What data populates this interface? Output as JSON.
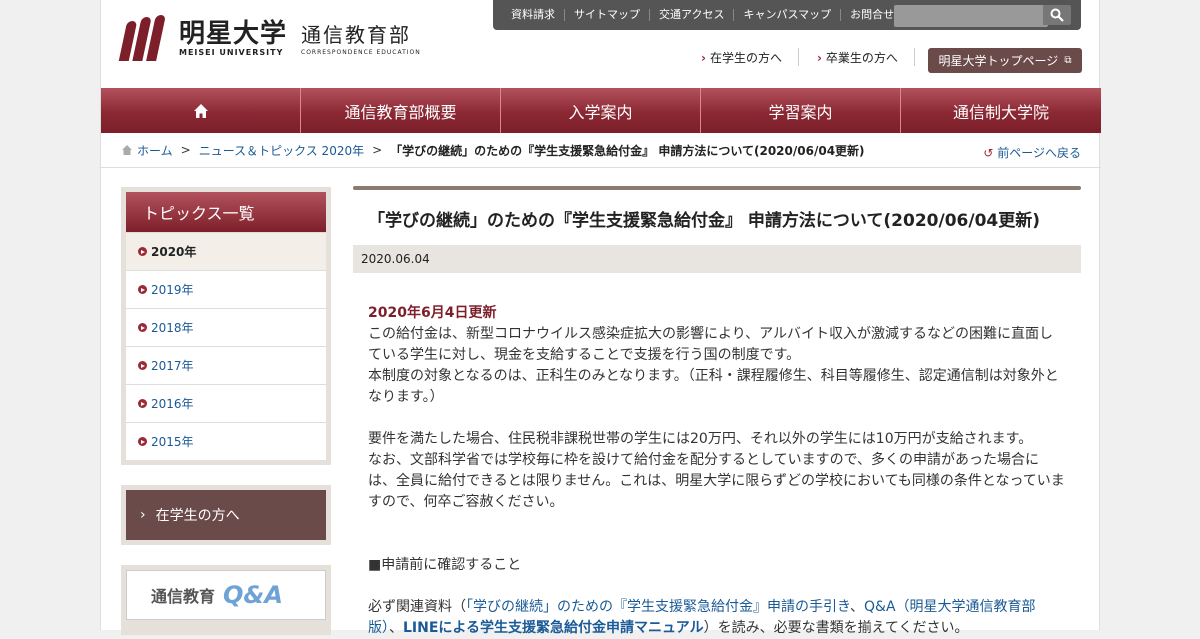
{
  "logo": {
    "brand_ja": "明星大学",
    "brand_en": "MEISEI UNIVERSITY",
    "dept_ja": "通信教育部",
    "dept_en": "CORRESPONDENCE EDUCATION"
  },
  "util_links": [
    "資料請求",
    "サイトマップ",
    "交通アクセス",
    "キャンパスマップ",
    "お問合せ"
  ],
  "search": {
    "placeholder": ""
  },
  "sub_links": [
    "在学生の方へ",
    "卒業生の方へ"
  ],
  "top_button": "明星大学トップページ",
  "gnav": [
    "通信教育部概要",
    "入学案内",
    "学習案内",
    "通信制大学院"
  ],
  "breadcrumb": {
    "home": "ホーム",
    "news": "ニュース＆トピックス 2020年",
    "current": "「学びの継続」のための『学生支援緊急給付金』 申請方法について(2020/06/04更新)",
    "back": "前ページへ戻る"
  },
  "sidebar": {
    "topics_title": "トピックス一覧",
    "years": [
      "2020年",
      "2019年",
      "2018年",
      "2017年",
      "2016年",
      "2015年"
    ],
    "student_link": "在学生の方へ",
    "qa_text": "通信教育",
    "qa_mark": "Q&A"
  },
  "article": {
    "title": "「学びの継続」のための『学生支援緊急給付金』 申請方法について(2020/06/04更新)",
    "date": "2020.06.04",
    "update": "2020年6月4日更新",
    "p1": "この給付金は、新型コロナウイルス感染症拡大の影響により、アルバイト収入が激減するなどの困難に直面している学生に対し、現金を支給することで支援を行う国の制度です。",
    "p2": "本制度の対象となるのは、正科生のみとなります。（正科・課程履修生、科目等履修生、認定通信制は対象外となります。）",
    "p3": "要件を満たした場合、住民税非課税世帯の学生には20万円、それ以外の学生には10万円が支給されます。",
    "p4": "なお、文部科学省では学校毎に枠を設けて給付金を配分するとしていますので、多くの申請があった場合には、全員に給付できるとは限りません。これは、明星大学に限らずどの学校においても同様の条件となっていますので、何卒ご容赦ください。",
    "p5": "■申請前に確認すること",
    "p6_pre": "必ず関連資料（",
    "p6_link1": "「学びの継続」のための『学生支援緊急給付金』申請の手引き",
    "p6_sep1": "、",
    "p6_link2": "Q&A（明星大学通信教育部版）",
    "p6_sep2": "、",
    "p6_link3": "LINEによる学生支援緊急給付金申請マニュアル",
    "p6_post": "）を読み、必要な書類を揃えてください。"
  }
}
